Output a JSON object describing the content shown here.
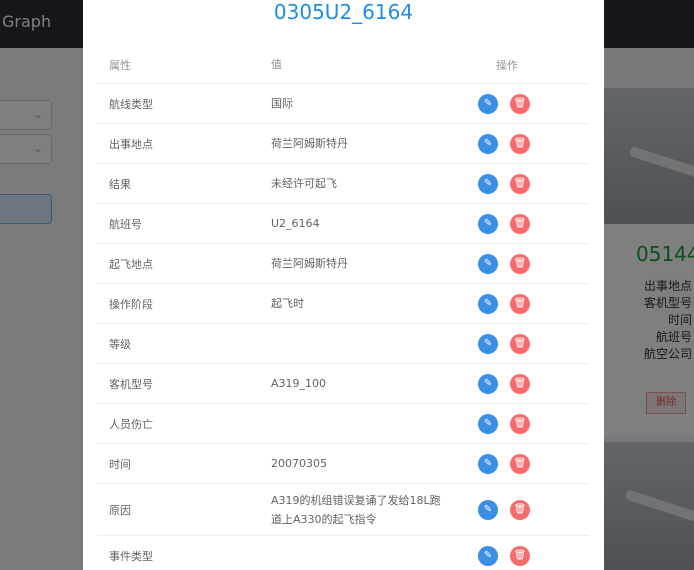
{
  "background": {
    "brand": "Graph",
    "card_code": "05144",
    "card_lines": [
      "出事地点",
      "客机型号",
      "时间",
      "航班号",
      "航空公司"
    ],
    "delete_label": "删除"
  },
  "modal": {
    "title": "0305U2_6164",
    "headers": {
      "property": "属性",
      "value": "值",
      "action": "操作"
    },
    "rows": [
      {
        "property": "航线类型",
        "value": "国际"
      },
      {
        "property": "出事地点",
        "value": "荷兰阿姆斯特丹"
      },
      {
        "property": "结果",
        "value": "未经许可起飞"
      },
      {
        "property": "航班号",
        "value": "U2_6164"
      },
      {
        "property": "起飞地点",
        "value": "荷兰阿姆斯特丹"
      },
      {
        "property": "操作阶段",
        "value": "起飞时"
      },
      {
        "property": "等级",
        "value": ""
      },
      {
        "property": "客机型号",
        "value": "A319_100"
      },
      {
        "property": "人员伤亡",
        "value": ""
      },
      {
        "property": "时间",
        "value": "20070305"
      },
      {
        "property": "原因",
        "value": "A319的机组错误复诵了发给18L跑道上A330的起飞指令"
      },
      {
        "property": "事件类型",
        "value": ""
      }
    ],
    "icons": {
      "edit": "edit-pencil-icon",
      "delete": "trash-icon"
    },
    "colors": {
      "title": "#1f8ceb",
      "edit": "#3a8ee6",
      "delete": "#f56c6c"
    }
  }
}
